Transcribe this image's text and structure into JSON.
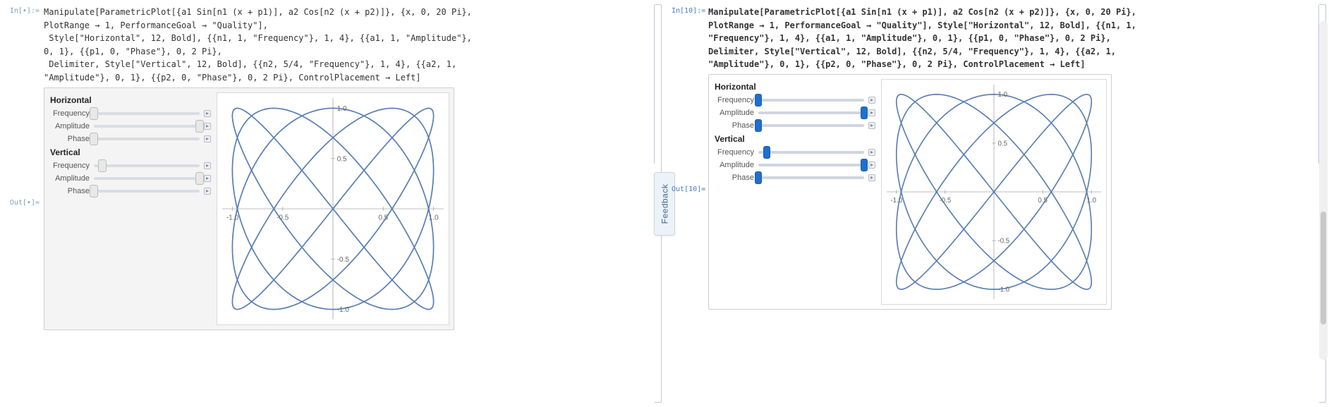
{
  "feedback_label": "Feedback",
  "left": {
    "in_label": "In[•]:=",
    "out_label": "Out[•]=",
    "code": "Manipulate[ParametricPlot[{a1 Sin[n1 (x + p1)], a2 Cos[n2 (x + p2)]}, {x, 0, 20 Pi}, PlotRange → 1, PerformanceGoal → \"Quality\"],\n Style[\"Horizontal\", 12, Bold], {{n1, 1, \"Frequency\"}, 1, 4}, {{a1, 1, \"Amplitude\"}, 0, 1}, {{p1, 0, \"Phase\"}, 0, 2 Pi},\n Delimiter, Style[\"Vertical\", 12, Bold], {{n2, 5/4, \"Frequency\"}, 1, 4}, {{a2, 1, \"Amplitude\"}, 0, 1}, {{p2, 0, \"Phase\"}, 0, 2 Pi}, ControlPlacement → Left]",
    "groups": [
      {
        "title": "Horizontal",
        "sliders": [
          {
            "label": "Frequency",
            "pos": 0.0
          },
          {
            "label": "Amplitude",
            "pos": 1.0
          },
          {
            "label": "Phase",
            "pos": 0.0
          }
        ]
      },
      {
        "title": "Vertical",
        "sliders": [
          {
            "label": "Frequency",
            "pos": 0.0833
          },
          {
            "label": "Amplitude",
            "pos": 1.0
          },
          {
            "label": "Phase",
            "pos": 0.0
          }
        ]
      }
    ]
  },
  "right": {
    "in_label": "In[10]:=",
    "out_label": "Out[10]=",
    "code": "Manipulate[ParametricPlot[{a1 Sin[n1 (x + p1)], a2 Cos[n2 (x + p2)]}, {x, 0, 20 Pi}, PlotRange → 1, PerformanceGoal → \"Quality\"], Style[\"Horizontal\", 12, Bold], {{n1, 1, \"Frequency\"}, 1, 4}, {{a1, 1, \"Amplitude\"}, 0, 1}, {{p1, 0, \"Phase\"}, 0, 2 Pi}, Delimiter, Style[\"Vertical\", 12, Bold], {{n2, 5/4, \"Frequency\"}, 1, 4}, {{a2, 1, \"Amplitude\"}, 0, 1}, {{p2, 0, \"Phase\"}, 0, 2 Pi}, ControlPlacement → Left]",
    "groups": [
      {
        "title": "Horizontal",
        "sliders": [
          {
            "label": "Frequency",
            "pos": 0.0
          },
          {
            "label": "Amplitude",
            "pos": 1.0
          },
          {
            "label": "Phase",
            "pos": 0.0
          }
        ]
      },
      {
        "title": "Vertical",
        "sliders": [
          {
            "label": "Frequency",
            "pos": 0.0833
          },
          {
            "label": "Amplitude",
            "pos": 1.0
          },
          {
            "label": "Phase",
            "pos": 0.0
          }
        ]
      }
    ]
  },
  "chart_data": {
    "type": "line",
    "title": "",
    "xlabel": "",
    "ylabel": "",
    "xlim": [
      -1.0,
      1.0
    ],
    "ylim": [
      -1.0,
      1.0
    ],
    "x_ticks": [
      -1.0,
      -0.5,
      0.5,
      1.0
    ],
    "y_ticks": [
      -1.0,
      -0.5,
      0.5,
      1.0
    ],
    "parametric": {
      "x_expr": "a1*sin(n1*(t+p1))",
      "y_expr": "a2*cos(n2*(t+p2))",
      "params": {
        "a1": 1,
        "n1": 1,
        "p1": 0,
        "a2": 1,
        "n2": 1.25,
        "p2": 0
      },
      "t_range": [
        0,
        62.8318530718
      ],
      "samples": 1200
    },
    "series_color": "#5a7fb2"
  }
}
